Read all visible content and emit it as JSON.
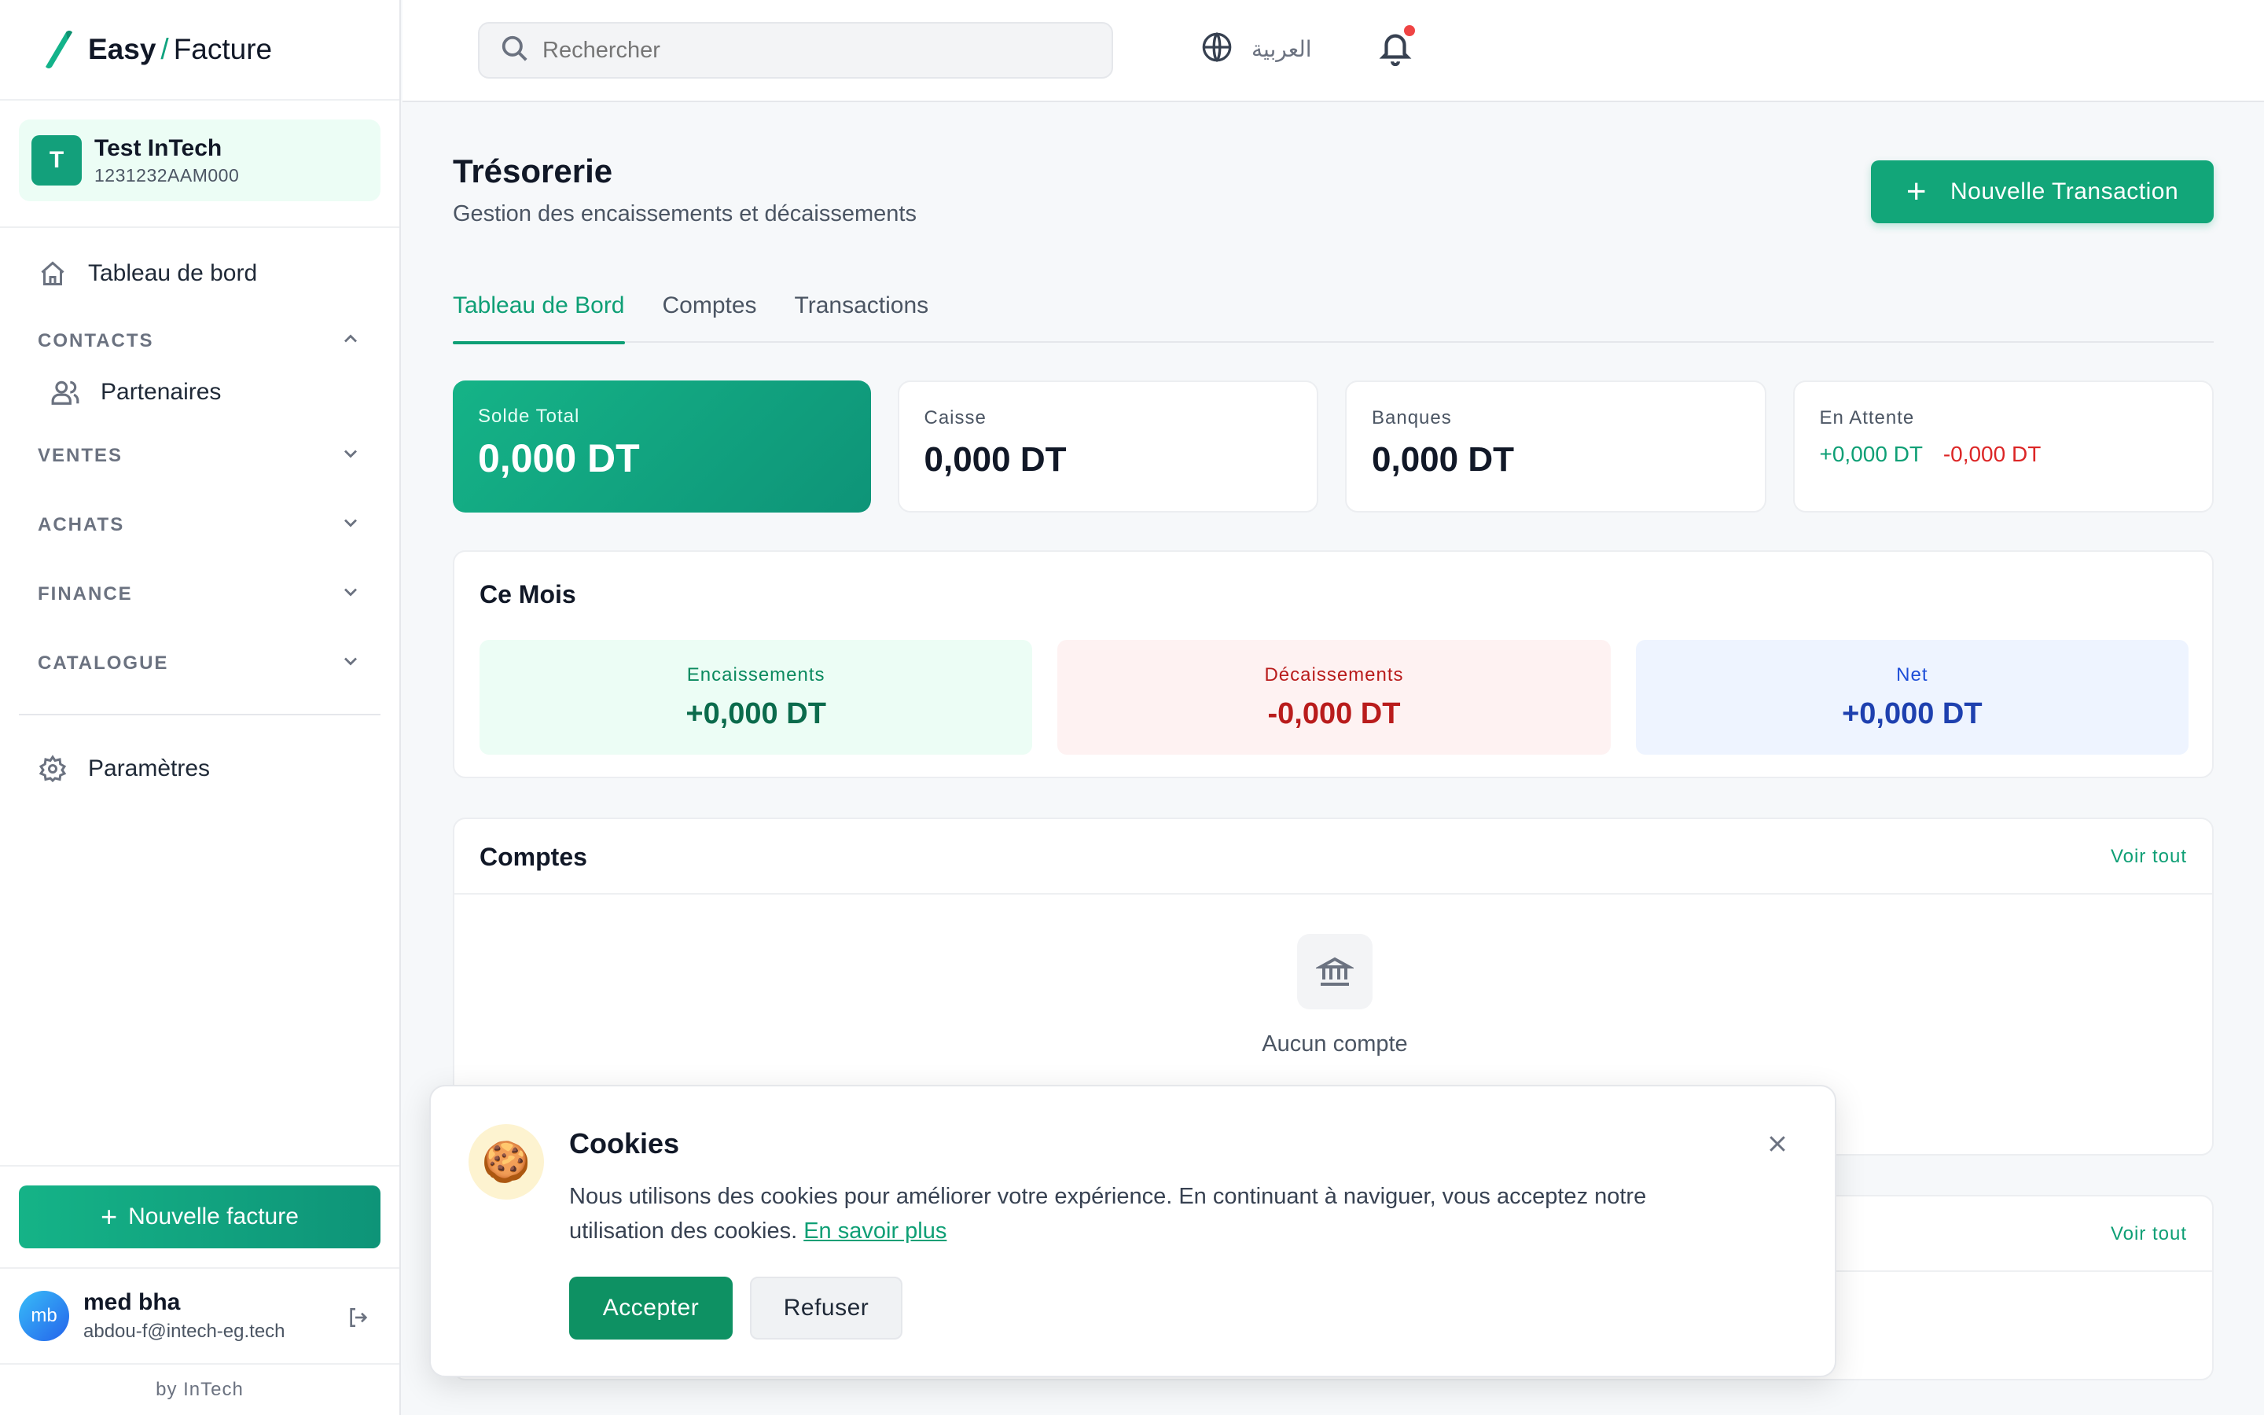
{
  "app": {
    "logo_easy": "Easy",
    "logo_slash": "/",
    "logo_facture": "Facture"
  },
  "company": {
    "initial": "T",
    "name": "Test InTech",
    "id": "1231232AAM000"
  },
  "sidebar": {
    "dashboard": "Tableau de bord",
    "sections": [
      {
        "label": "CONTACTS",
        "expanded": true
      },
      {
        "label": "VENTES",
        "expanded": false
      },
      {
        "label": "ACHATS",
        "expanded": false
      },
      {
        "label": "FINANCE",
        "expanded": false
      },
      {
        "label": "CATALOGUE",
        "expanded": false
      }
    ],
    "partners": "Partenaires",
    "settings": "Paramètres",
    "new_invoice": "Nouvelle facture",
    "byline": "by InTech"
  },
  "user": {
    "initials": "mb",
    "name": "med bha",
    "email": "abdou-f@intech-eg.tech"
  },
  "topbar": {
    "search_placeholder": "Rechercher",
    "language": "العربية"
  },
  "page": {
    "title": "Trésorerie",
    "subtitle": "Gestion des encaissements et décaissements",
    "new_transaction": "Nouvelle Transaction",
    "tabs": [
      "Tableau de Bord",
      "Comptes",
      "Transactions"
    ],
    "active_tab": 0
  },
  "stats": {
    "total_label": "Solde Total",
    "total_value": "0,000 DT",
    "cash_label": "Caisse",
    "cash_value": "0,000 DT",
    "banks_label": "Banques",
    "banks_value": "0,000 DT",
    "pending_label": "En Attente",
    "pending_in": "+0,000 DT",
    "pending_out": "-0,000 DT"
  },
  "month": {
    "title": "Ce Mois",
    "in_label": "Encaissements",
    "in_value": "+0,000 DT",
    "out_label": "Décaissements",
    "out_value": "-0,000 DT",
    "net_label": "Net",
    "net_value": "+0,000 DT"
  },
  "accounts": {
    "title": "Comptes",
    "see_all": "Voir tout",
    "empty": "Aucun compte"
  },
  "transactions_card": {
    "see_all": "Voir tout"
  },
  "cookie": {
    "icon": "🍪",
    "title": "Cookies",
    "text": "Nous utilisons des cookies pour améliorer votre expérience. En continuant à naviguer, vous acceptez notre utilisation des cookies.",
    "link": "En savoir plus",
    "accept": "Accepter",
    "refuse": "Refuser"
  },
  "colors": {
    "brand": "#12a679",
    "negative": "#dc2626",
    "net": "#1e40af"
  }
}
